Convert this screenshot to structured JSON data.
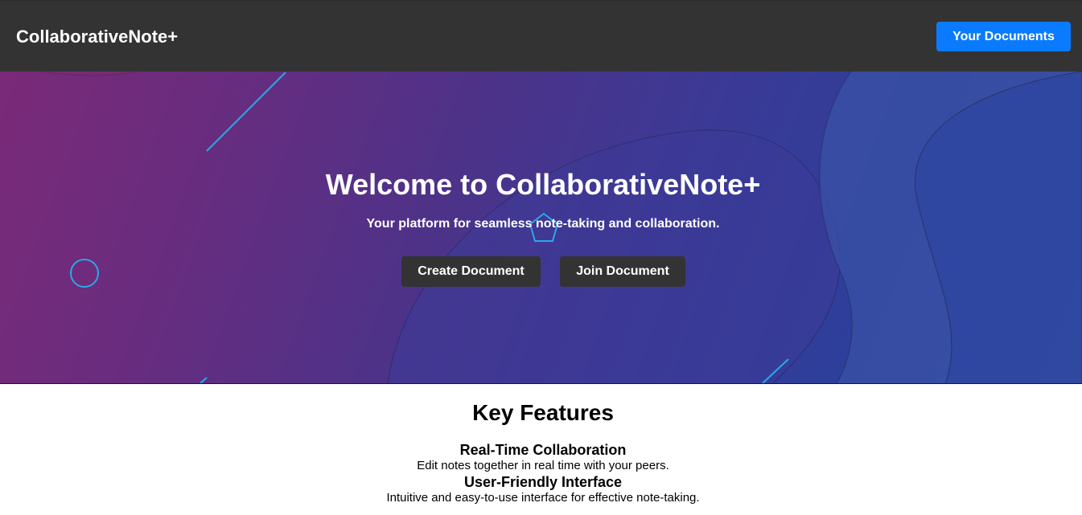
{
  "header": {
    "brand": "CollaborativeNote+",
    "nav_button_label": "Your Documents"
  },
  "hero": {
    "title": "Welcome to CollaborativeNote+",
    "subtitle": "Your platform for seamless note-taking and collaboration.",
    "create_button_label": "Create Document",
    "join_button_label": "Join Document"
  },
  "features": {
    "title": "Key Features",
    "items": [
      {
        "title": "Real-Time Collaboration",
        "description": "Edit notes together in real time with your peers."
      },
      {
        "title": "User-Friendly Interface",
        "description": "Intuitive and easy-to-use interface for effective note-taking."
      }
    ]
  },
  "colors": {
    "navbar_bg": "#333333",
    "primary_button": "#0a7bff",
    "hero_gradient_start": "#7a2a78",
    "hero_gradient_end": "#3048a0",
    "decor_line": "#2aa8e8"
  }
}
